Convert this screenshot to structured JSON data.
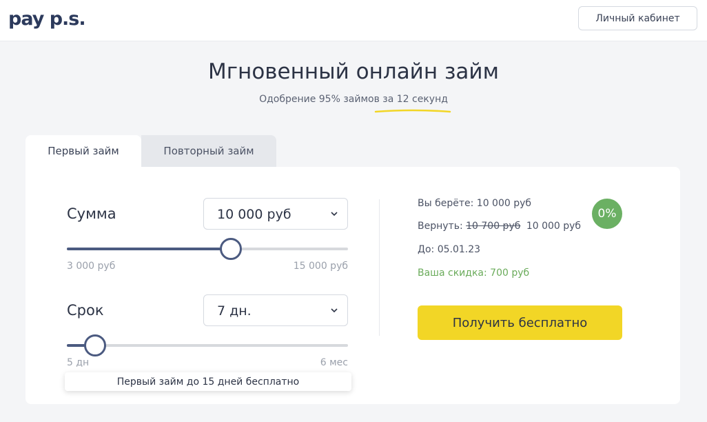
{
  "header": {
    "logo_text": "pay p.s.",
    "cabinet_label": "Личный кабинет"
  },
  "hero": {
    "title": "Мгновенный онлайн займ",
    "subtitle": "Одобрение 95% займов за 12 секунд",
    "accent_color": "#f2d626"
  },
  "tabs": [
    {
      "label": "Первый займ",
      "active": true
    },
    {
      "label": "Повторный займ",
      "active": false
    }
  ],
  "amount": {
    "label": "Сумма",
    "selected": "10 000 руб",
    "min_label": "3 000 руб",
    "max_label": "15 000 руб",
    "min": 3000,
    "max": 15000,
    "value": 10000
  },
  "term": {
    "label": "Срок",
    "selected": "7 дн.",
    "min_label": "5 дн",
    "max_label": "6 мес",
    "value_fraction": 0.1
  },
  "note": "Первый займ до 15 дней бесплатно",
  "summary": {
    "take_label": "Вы берёте:",
    "take_value": "10 000 руб",
    "return_label": "Вернуть:",
    "return_old": "10 700 руб",
    "return_new": "10 000 руб",
    "until_label": "До:",
    "until_value": "05.01.23",
    "discount_label": "Ваша скидка:",
    "discount_value": "700 руб",
    "rate_badge": "0%"
  },
  "cta_label": "Получить бесплатно",
  "icons": {
    "amount_chevron": "chevron-down-icon",
    "term_chevron": "chevron-down-icon"
  },
  "colors": {
    "slider": "#4b5a80",
    "badge": "#6bb063",
    "discount": "#6aab5a",
    "cta": "#f2d626"
  }
}
